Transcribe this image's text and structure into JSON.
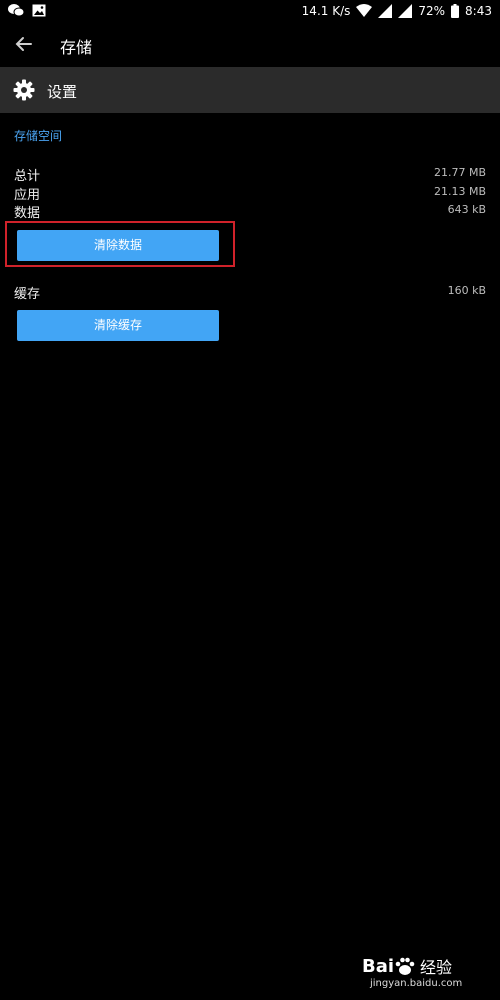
{
  "status_bar": {
    "net_speed": "14.1 K/s",
    "battery": "72%",
    "time": "8:43"
  },
  "app_bar": {
    "title": "存储"
  },
  "settings_row": {
    "label": "设置"
  },
  "storage": {
    "section_title": "存储空间",
    "rows": [
      {
        "label": "总计",
        "value": "21.77 MB"
      },
      {
        "label": "应用",
        "value": "21.13 MB"
      },
      {
        "label": "数据",
        "value": "643 kB"
      }
    ],
    "clear_data_label": "清除数据"
  },
  "cache": {
    "label": "缓存",
    "value": "160 kB",
    "clear_cache_label": "清除缓存"
  },
  "watermark": {
    "brand": "Bai",
    "product": "经验",
    "url": "jingyan.baidu.com"
  },
  "colors": {
    "accent": "#42a5f5",
    "section_title": "#4aa3f0",
    "highlight": "#d0222a",
    "settings_bg": "#2b2b2b"
  }
}
